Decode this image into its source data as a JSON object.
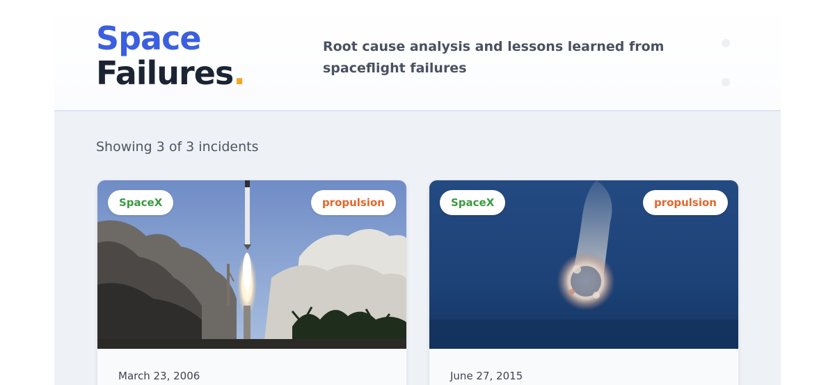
{
  "header": {
    "title_line1": "Space",
    "title_line2": "Failures",
    "title_dot": ".",
    "tagline": "Root cause analysis and lessons learned from spaceflight failures"
  },
  "results": {
    "count_text": "Showing 3 of 3 incidents"
  },
  "cards": [
    {
      "provider": "SpaceX",
      "category": "propulsion",
      "date": "March 23, 2006",
      "image": "rocket-launch-image"
    },
    {
      "provider": "SpaceX",
      "category": "propulsion",
      "date": "June 27, 2015",
      "image": "rocket-explosion-image"
    }
  ],
  "colors": {
    "accent_blue": "#3b5fe0",
    "accent_dot": "#f5a623",
    "provider_green": "#3a9a3f",
    "category_orange": "#e5662a"
  }
}
